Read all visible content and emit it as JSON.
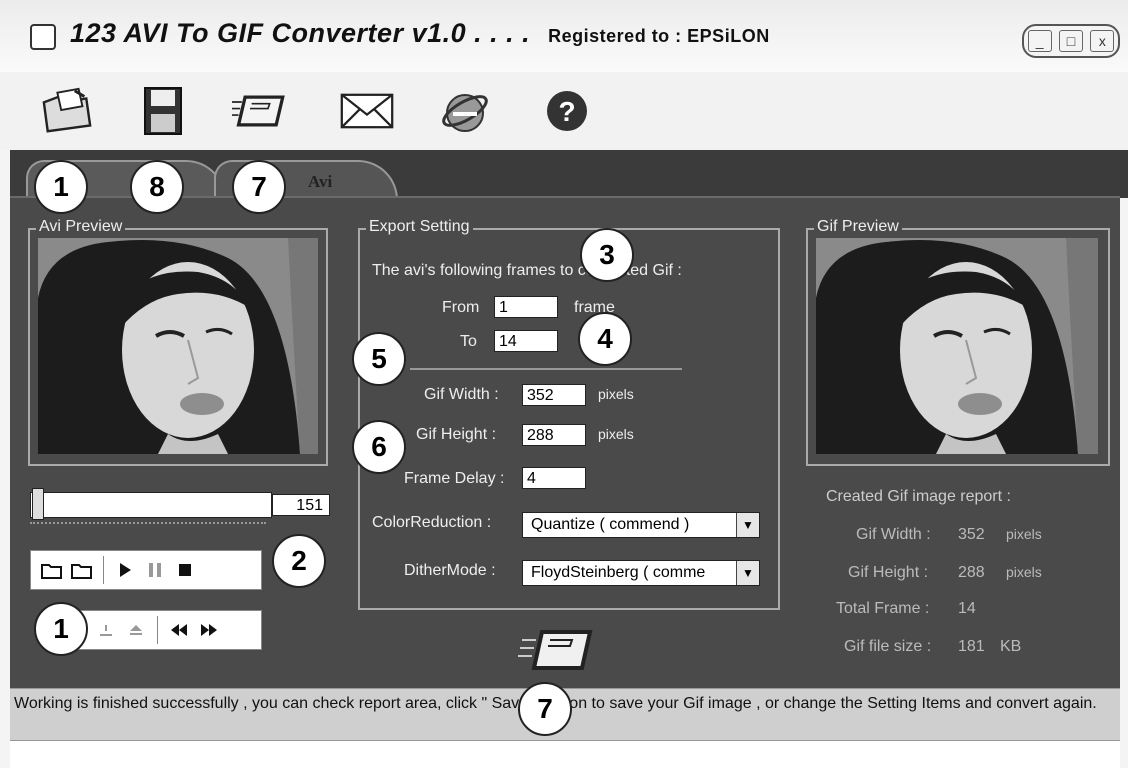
{
  "window": {
    "title": "123 AVI To GIF Converter v1.0 . . . .",
    "registered": "Registered to :  EPSiLON",
    "controls": [
      "_",
      "□",
      "x"
    ]
  },
  "toolbar": {
    "icons": [
      "open-folder-icon",
      "save-disk-icon",
      "convert-icon",
      "mail-icon",
      "browser-icon",
      "help-icon"
    ]
  },
  "tabs": [
    {
      "label": ""
    },
    {
      "label": "Avi"
    }
  ],
  "avi_preview": {
    "label": "Avi Preview",
    "slider_value": "151"
  },
  "export": {
    "label": "Export  Setting",
    "frames_text": "The avi's following frames to converted Gif :",
    "from_label": "From",
    "from_value": "1",
    "from_unit": "frame",
    "to_label": "To",
    "to_value": "14",
    "width_label": "Gif Width :",
    "width_value": "352",
    "width_unit": "pixels",
    "height_label": "Gif Height :",
    "height_value": "288",
    "height_unit": "pixels",
    "delay_label": "Frame Delay :",
    "delay_value": "4",
    "color_label": "ColorReduction :",
    "color_value": "Quantize  ( commend )",
    "dither_label": "DitherMode :",
    "dither_value": "FloydSteinberg ( comme"
  },
  "gif_preview": {
    "label": "Gif Preview"
  },
  "report": {
    "title": "Created Gif image report :",
    "width_label": "Gif Width :",
    "width_value": "352",
    "width_unit": "pixels",
    "height_label": "Gif Height :",
    "height_value": "288",
    "height_unit": "pixels",
    "frames_label": "Total Frame :",
    "frames_value": "14",
    "size_label": "Gif file size :",
    "size_value": "181",
    "size_unit": "KB"
  },
  "status": {
    "text": "Working is finished successfully , you can check report area, click \" Save \" button to save your Gif image , or change the Setting Items and convert again."
  },
  "badges": [
    "1",
    "8",
    "7",
    "3",
    "4",
    "5",
    "6",
    "2",
    "1",
    "7"
  ],
  "colors": {
    "panel": "#4a4a4a",
    "tabstrip": "#3b3b3b",
    "status": "#cfcfcf"
  }
}
